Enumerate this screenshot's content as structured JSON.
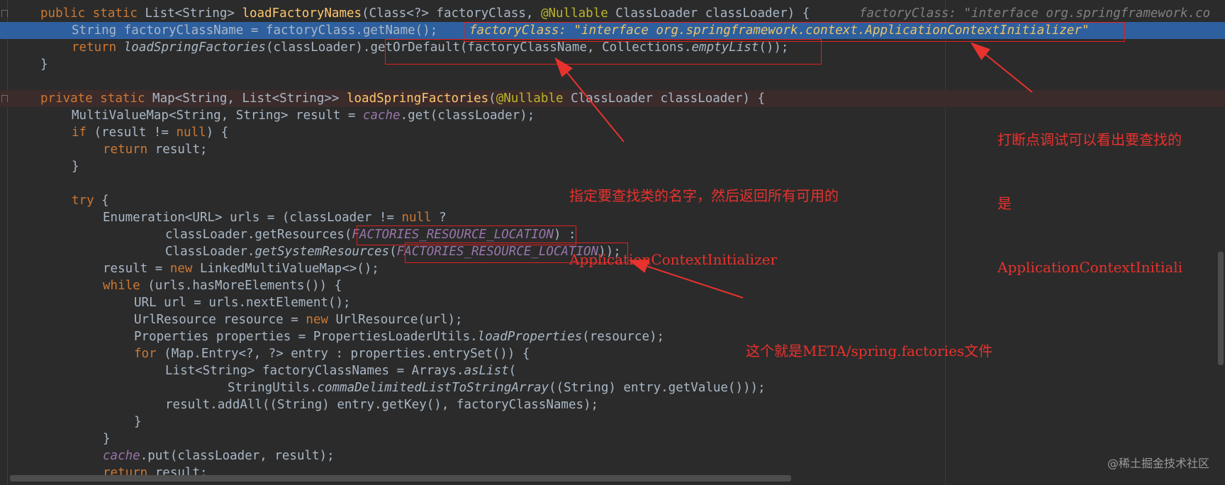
{
  "code_lines": [
    {
      "parts": [
        {
          "t": "public static ",
          "c": "kw"
        },
        {
          "t": "List<String> ",
          "c": ""
        },
        {
          "t": "loadFactoryNames",
          "c": "fn"
        },
        {
          "t": "(Class<?> factoryClass, ",
          "c": ""
        },
        {
          "t": "@Nullable ",
          "c": "an"
        },
        {
          "t": "ClassLoader classLoader) {",
          "c": ""
        }
      ],
      "inline": "factoryClass: \"interface org.springframework.co"
    },
    {
      "parts": [
        {
          "t": "String factoryClassName = factoryClass.getName();",
          "c": ""
        }
      ],
      "inline": "factoryClass: \"interface org.springframework.context.ApplicationContextInitializer\""
    },
    {
      "parts": [
        {
          "t": "return ",
          "c": "kw"
        },
        {
          "t": "loadSpringFactories",
          "c": "it"
        },
        {
          "t": "(classLoader).getOrDefault(factoryClassName, Collections.",
          "c": ""
        },
        {
          "t": "emptyList",
          "c": "it"
        },
        {
          "t": "());",
          "c": ""
        }
      ]
    },
    {
      "parts": [
        {
          "t": "}",
          "c": ""
        }
      ]
    },
    {
      "parts": [
        {
          "t": "private static ",
          "c": "kw"
        },
        {
          "t": "Map<String, List<String>> ",
          "c": ""
        },
        {
          "t": "loadSpringFactories",
          "c": "fn"
        },
        {
          "t": "(",
          "c": ""
        },
        {
          "t": "@Nullable ",
          "c": "an"
        },
        {
          "t": "ClassLoader classLoader) {",
          "c": ""
        }
      ]
    },
    {
      "parts": [
        {
          "t": "MultiValueMap<String, String> result = ",
          "c": ""
        },
        {
          "t": "cache",
          "c": "st"
        },
        {
          "t": ".get(classLoader);",
          "c": ""
        }
      ]
    },
    {
      "parts": [
        {
          "t": "if ",
          "c": "kw"
        },
        {
          "t": "(result != ",
          "c": ""
        },
        {
          "t": "null",
          "c": "kw"
        },
        {
          "t": ") {",
          "c": ""
        }
      ]
    },
    {
      "parts": [
        {
          "t": "return ",
          "c": "kw"
        },
        {
          "t": "result;",
          "c": ""
        }
      ]
    },
    {
      "parts": [
        {
          "t": "}",
          "c": ""
        }
      ]
    },
    {
      "parts": [
        {
          "t": "try ",
          "c": "kw"
        },
        {
          "t": "{",
          "c": ""
        }
      ]
    },
    {
      "parts": [
        {
          "t": "Enumeration<URL> urls = (classLoader != ",
          "c": ""
        },
        {
          "t": "null ",
          "c": "kw"
        },
        {
          "t": "?",
          "c": ""
        }
      ]
    },
    {
      "parts": [
        {
          "t": "classLoader.getResources(",
          "c": ""
        },
        {
          "t": "FACTORIES_RESOURCE_LOCATION",
          "c": "st"
        },
        {
          "t": ") :",
          "c": ""
        }
      ]
    },
    {
      "parts": [
        {
          "t": "ClassLoader.",
          "c": ""
        },
        {
          "t": "getSystemResources",
          "c": "it"
        },
        {
          "t": "(",
          "c": ""
        },
        {
          "t": "FACTORIES_RESOURCE_LOCATION",
          "c": "st"
        },
        {
          "t": "));",
          "c": ""
        }
      ]
    },
    {
      "parts": [
        {
          "t": "result = ",
          "c": ""
        },
        {
          "t": "new ",
          "c": "kw"
        },
        {
          "t": "LinkedMultiValueMap<>();",
          "c": ""
        }
      ]
    },
    {
      "parts": [
        {
          "t": "while ",
          "c": "kw"
        },
        {
          "t": "(urls.hasMoreElements()) {",
          "c": ""
        }
      ]
    },
    {
      "parts": [
        {
          "t": "URL url = urls.nextElement();",
          "c": ""
        }
      ]
    },
    {
      "parts": [
        {
          "t": "UrlResource resource = ",
          "c": ""
        },
        {
          "t": "new ",
          "c": "kw"
        },
        {
          "t": "UrlResource(url);",
          "c": ""
        }
      ]
    },
    {
      "parts": [
        {
          "t": "Properties properties = PropertiesLoaderUtils.",
          "c": ""
        },
        {
          "t": "loadProperties",
          "c": "it"
        },
        {
          "t": "(resource);",
          "c": ""
        }
      ]
    },
    {
      "parts": [
        {
          "t": "for ",
          "c": "kw"
        },
        {
          "t": "(Map.Entry<?, ?> entry : properties.entrySet()) {",
          "c": ""
        }
      ]
    },
    {
      "parts": [
        {
          "t": "List<String> factoryClassNames = Arrays.",
          "c": ""
        },
        {
          "t": "asList",
          "c": "it"
        },
        {
          "t": "(",
          "c": ""
        }
      ]
    },
    {
      "parts": [
        {
          "t": "StringUtils.",
          "c": ""
        },
        {
          "t": "commaDelimitedListToStringArray",
          "c": "it"
        },
        {
          "t": "((String) entry.getValue()));",
          "c": ""
        }
      ]
    },
    {
      "parts": [
        {
          "t": "result.addAll((String) entry.getKey(), factoryClassNames);",
          "c": ""
        }
      ]
    },
    {
      "parts": [
        {
          "t": "}",
          "c": ""
        }
      ]
    },
    {
      "parts": [
        {
          "t": "}",
          "c": ""
        }
      ]
    },
    {
      "parts": [
        {
          "t": "cache",
          "c": "st"
        },
        {
          "t": ".put(classLoader, result);",
          "c": ""
        }
      ]
    },
    {
      "parts": [
        {
          "t": "return ",
          "c": "kw"
        },
        {
          "t": "result;",
          "c": ""
        }
      ]
    }
  ],
  "annotations": {
    "note1": [
      "打断点调试可以看出要查找的",
      "是",
      "ApplicationContextInitiali"
    ],
    "note2": [
      "指定要查找类的名字，然后返回所有可用的",
      "ApplicationContextInitializer"
    ],
    "note3": [
      "这个就是META/spring.factories文件"
    ]
  },
  "watermark": "@稀土掘金技术社区",
  "colors": {
    "keyword": "#cc7832",
    "method": "#ffc66d",
    "static_field": "#9876aa",
    "annotation": "#bbb529",
    "debug_line": "#2e5f9e",
    "callout": "#e8322e"
  }
}
